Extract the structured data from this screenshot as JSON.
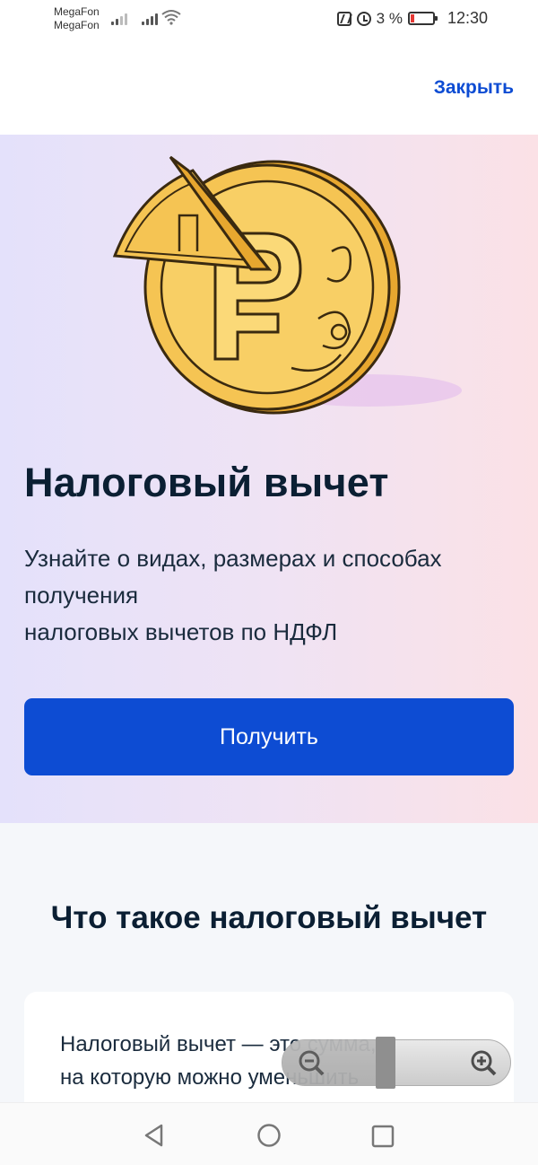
{
  "status_bar": {
    "carrier_1": "MegaFon",
    "carrier_2": "MegaFon",
    "battery_percent": "3 %",
    "time": "12:30"
  },
  "header": {
    "close_label": "Закрыть"
  },
  "hero": {
    "title": "Налоговый вычет",
    "subtitle_line_1": "Узнайте о видах, размерах и способах получения",
    "subtitle_line_2": "налоговых вычетов по НДФЛ",
    "button_label": "Получить",
    "illustration_icon": "ruble-coin-icon"
  },
  "section": {
    "title": "Что такое налоговый вычет",
    "card_line_1": "Налоговый вычет — это сумма,",
    "card_line_2": "на которую можно уменьшить"
  },
  "colors": {
    "accent": "#0d4cd3",
    "text_dark": "#0b1f33",
    "coin_gold": "#f5c453",
    "section_bg": "#f5f7fa"
  },
  "icons": {
    "zoom_out": "zoom-out-icon",
    "zoom_in": "zoom-in-icon",
    "nav_back": "back-triangle-icon",
    "nav_home": "home-circle-icon",
    "nav_recent": "recent-square-icon"
  }
}
